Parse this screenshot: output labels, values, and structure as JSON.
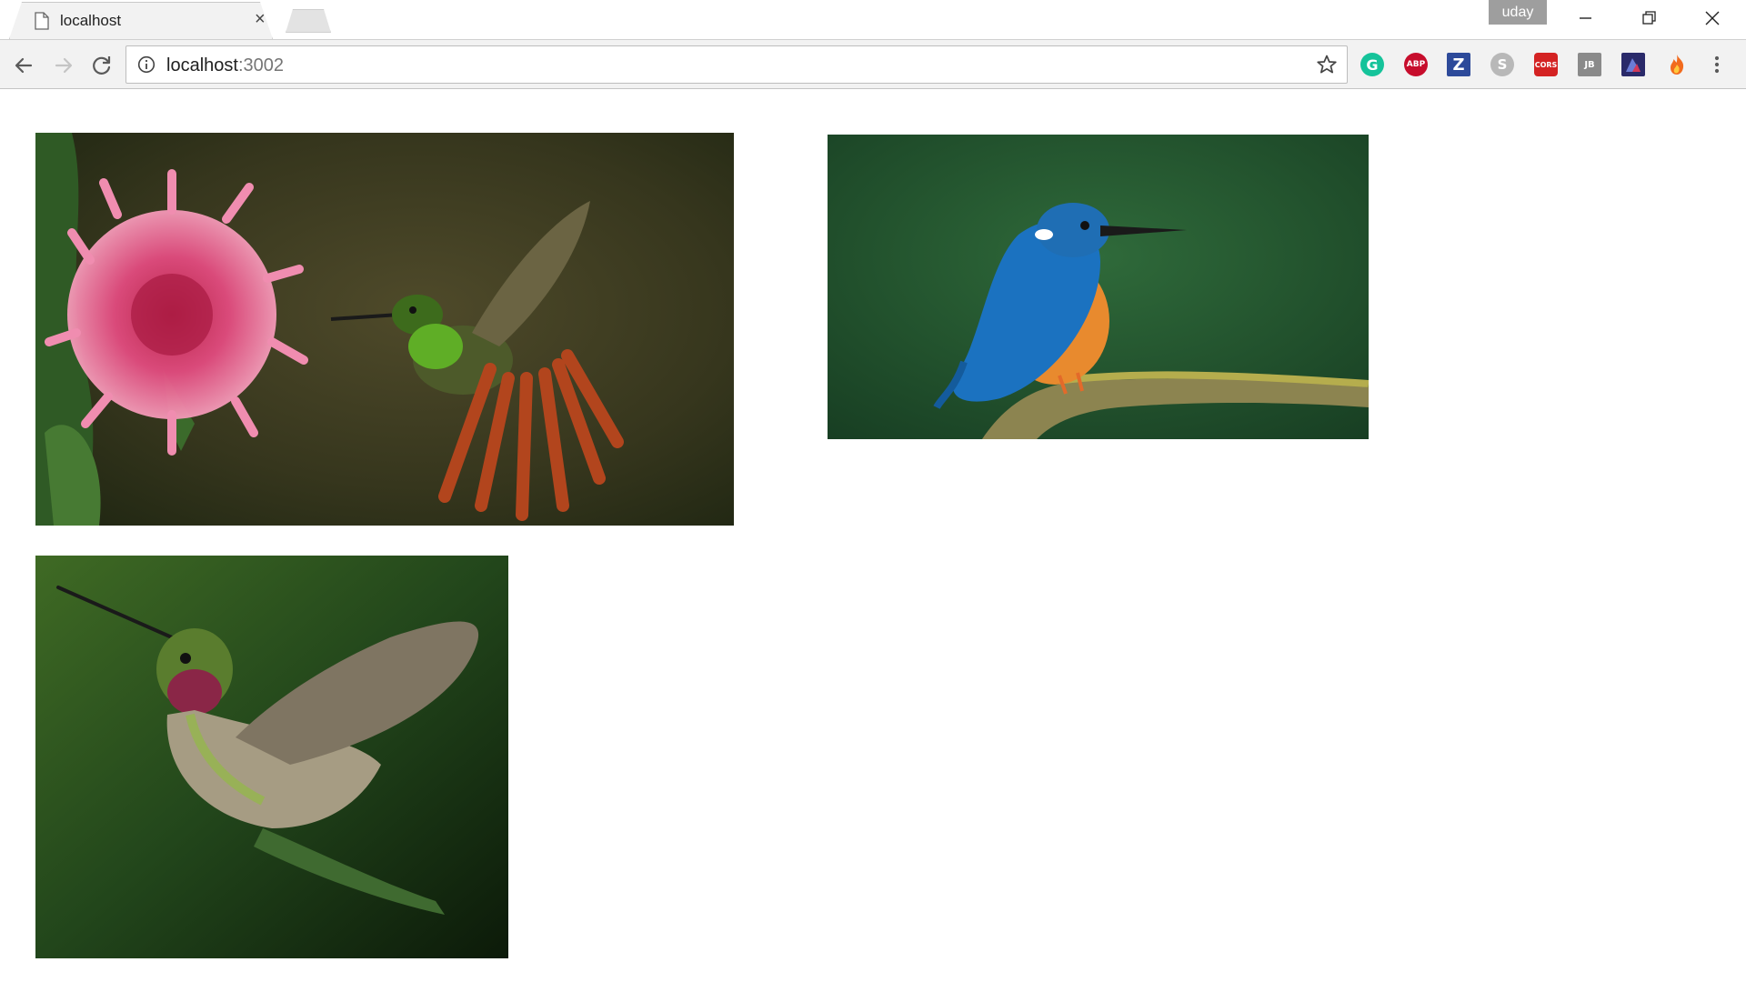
{
  "browser": {
    "tab_title": "localhost",
    "tab_close_glyph": "×",
    "profile_name": "uday",
    "address": {
      "host": "localhost",
      "port": ":3002"
    },
    "icons": {
      "back": "back-arrow-icon",
      "forward": "forward-arrow-icon",
      "reload": "reload-icon",
      "info": "info-icon",
      "bookmark": "star-icon",
      "menu": "kebab-menu-icon"
    },
    "extensions": [
      {
        "name": "grammarly",
        "glyph": "G",
        "color": "#15c39a"
      },
      {
        "name": "adblock-plus",
        "glyph": "ABP",
        "color": "#c70d2c"
      },
      {
        "name": "zotero",
        "glyph": "Z",
        "color": "#2d4a9a"
      },
      {
        "name": "skype",
        "glyph": "S",
        "color": "#b8b8b8"
      },
      {
        "name": "cors",
        "glyph": "CORS",
        "color": "#d42323"
      },
      {
        "name": "jetbrains",
        "glyph": "JB",
        "color": "#8a8a8a"
      },
      {
        "name": "dark-extension",
        "glyph": "",
        "color": "#2a2a6a"
      },
      {
        "name": "fire-extension",
        "glyph": "",
        "color": "#f26b1d"
      }
    ]
  },
  "page": {
    "photos": [
      {
        "name": "hummingbird-with-pink-flower-photo",
        "subject": "hummingbird hovering beside pink flower"
      },
      {
        "name": "kingfisher-on-branch-photo",
        "subject": "kingfisher perched on mossy branch"
      },
      {
        "name": "hummingbird-closeup-photo",
        "subject": "hummingbird in flight, dark green background"
      }
    ]
  }
}
